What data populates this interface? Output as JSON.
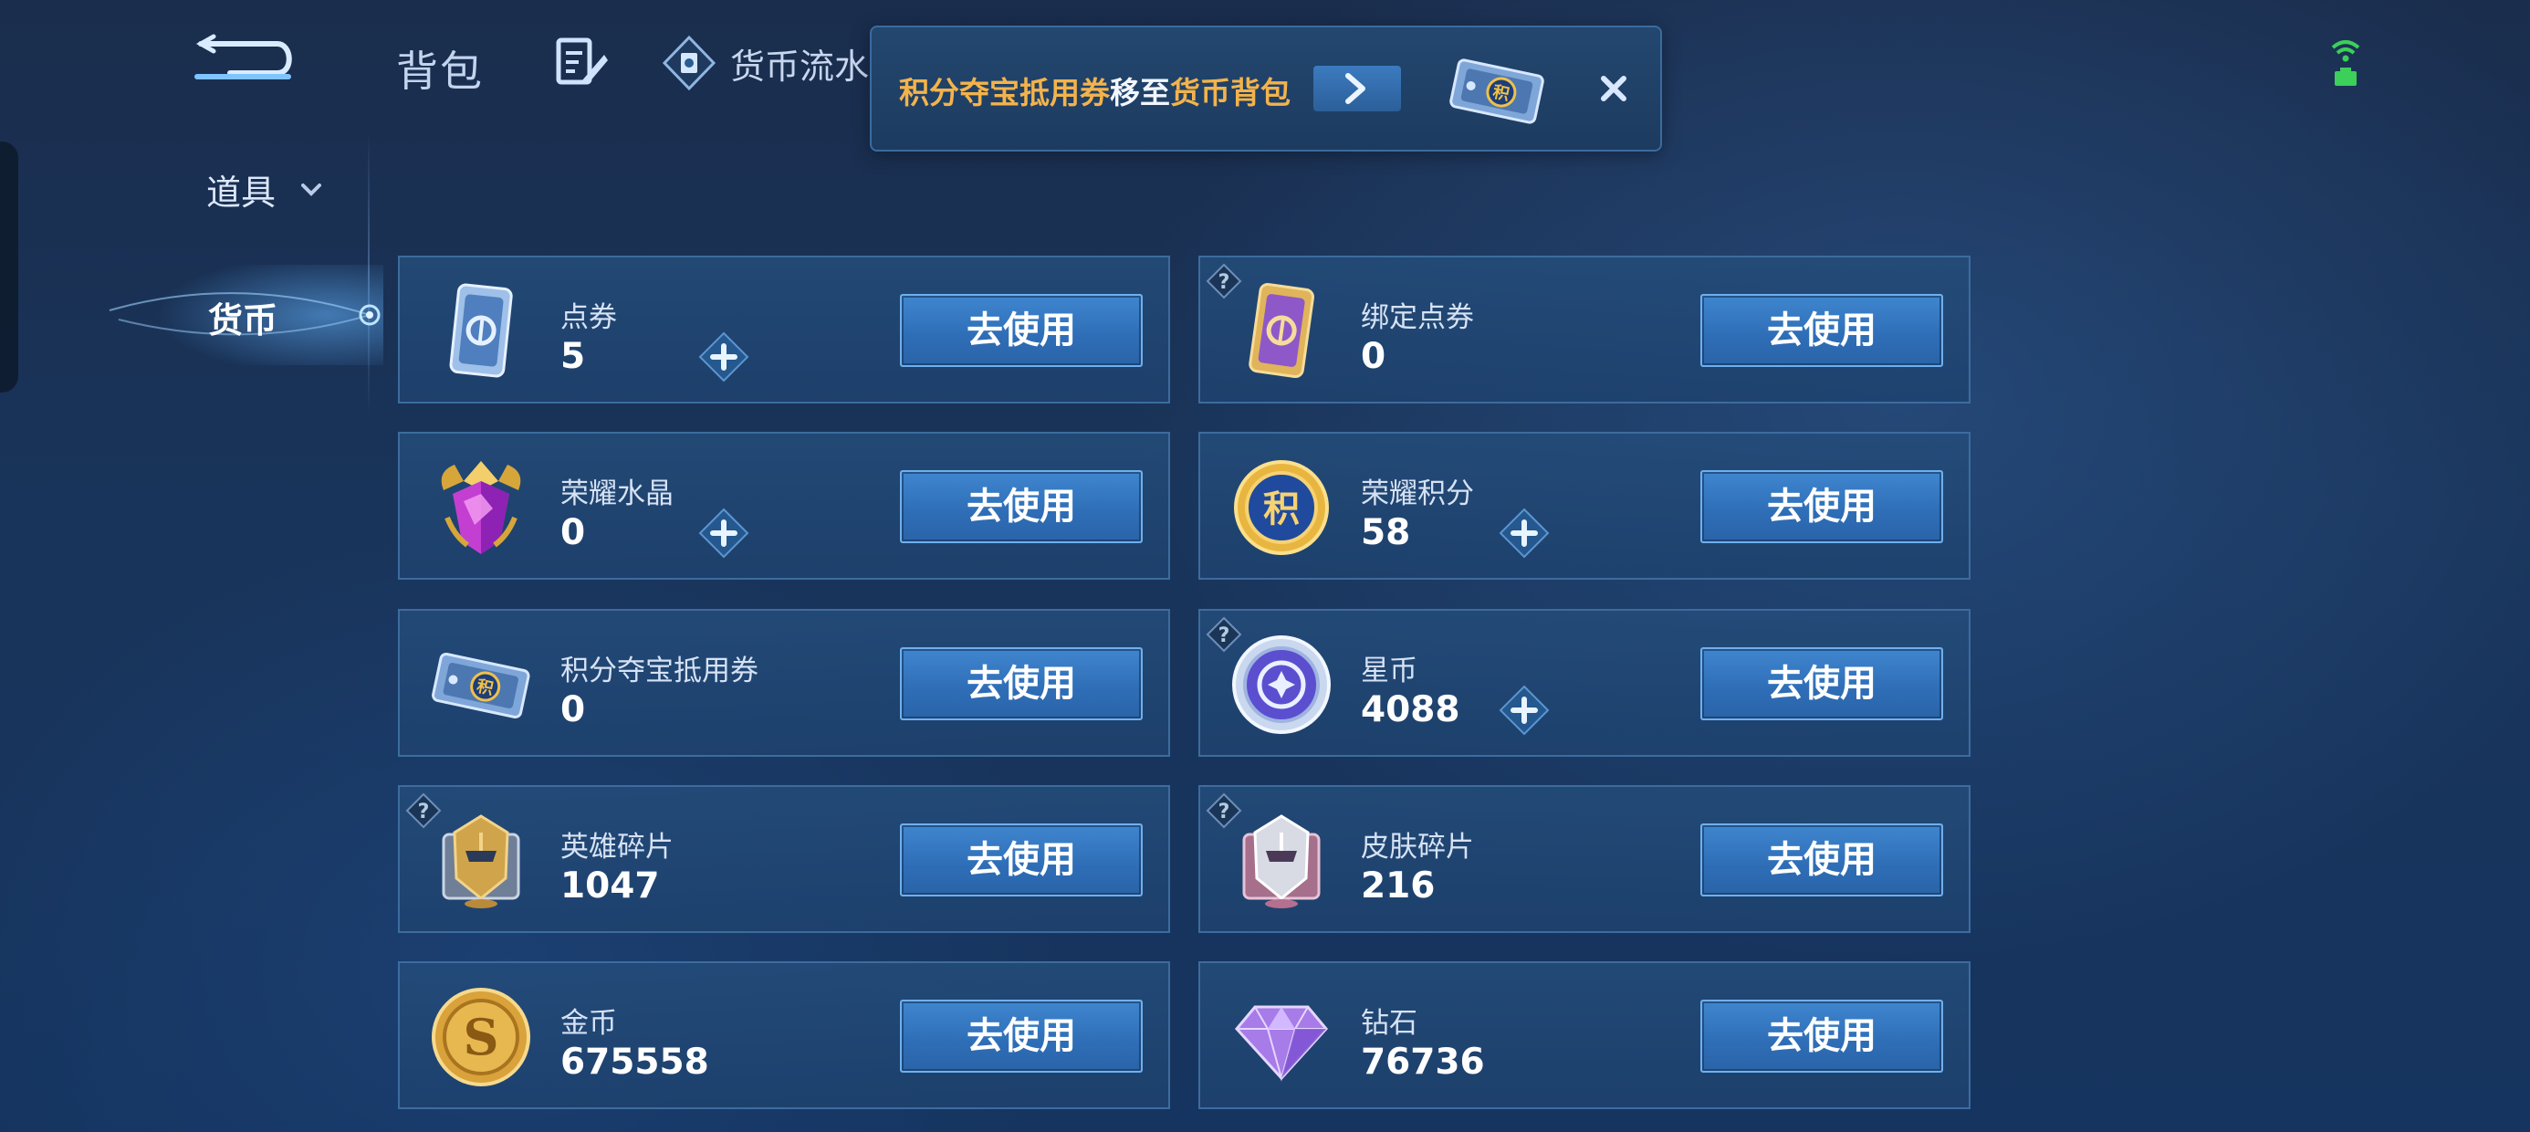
{
  "header": {
    "tabs": [
      {
        "label": "背包"
      },
      {
        "label": "货币流水"
      }
    ]
  },
  "toast": {
    "part1": "积分夺宝抵用券",
    "part2": "移至",
    "part3": "货币背包"
  },
  "sidebar": {
    "items": [
      {
        "label": "道具"
      },
      {
        "label": "货币"
      }
    ]
  },
  "currency_cards": [
    {
      "name": "点券",
      "amount": "5",
      "button": "去使用",
      "has_plus": true,
      "has_help": false,
      "icon": "coupon-icon"
    },
    {
      "name": "绑定点券",
      "amount": "0",
      "button": "去使用",
      "has_plus": false,
      "has_help": true,
      "icon": "bound-coupon-icon"
    },
    {
      "name": "荣耀水晶",
      "amount": "0",
      "button": "去使用",
      "has_plus": true,
      "has_help": false,
      "icon": "glory-crystal-icon"
    },
    {
      "name": "荣耀积分",
      "amount": "58",
      "button": "去使用",
      "has_plus": true,
      "has_help": false,
      "icon": "glory-points-icon"
    },
    {
      "name": "积分夺宝抵用券",
      "amount": "0",
      "button": "去使用",
      "has_plus": false,
      "has_help": false,
      "icon": "lottery-voucher-icon"
    },
    {
      "name": "星币",
      "amount": "4088",
      "button": "去使用",
      "has_plus": true,
      "has_help": true,
      "icon": "star-coin-icon"
    },
    {
      "name": "英雄碎片",
      "amount": "1047",
      "button": "去使用",
      "has_plus": false,
      "has_help": true,
      "icon": "hero-fragment-icon"
    },
    {
      "name": "皮肤碎片",
      "amount": "216",
      "button": "去使用",
      "has_plus": false,
      "has_help": true,
      "icon": "skin-fragment-icon"
    },
    {
      "name": "金币",
      "amount": "675558",
      "button": "去使用",
      "has_plus": false,
      "has_help": false,
      "icon": "gold-coin-icon"
    },
    {
      "name": "钻石",
      "amount": "76736",
      "button": "去使用",
      "has_plus": false,
      "has_help": false,
      "icon": "diamond-icon"
    }
  ]
}
